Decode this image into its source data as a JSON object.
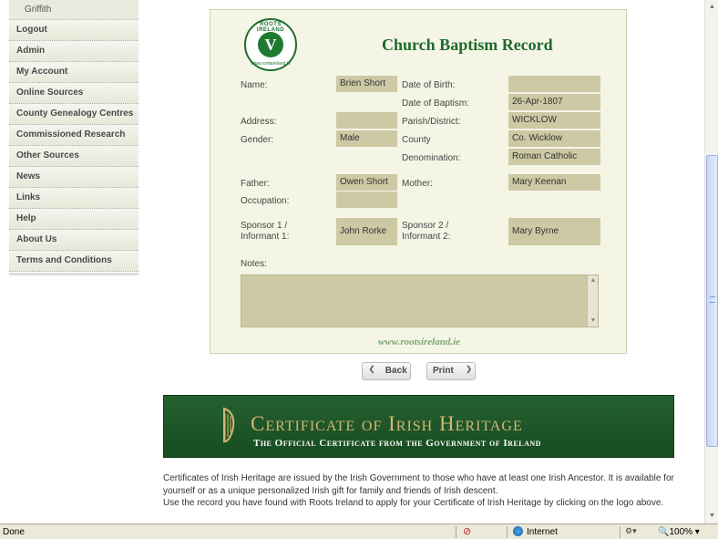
{
  "sidebar": {
    "sub_item": "Griffith",
    "items": [
      {
        "label": "Logout"
      },
      {
        "label": "Admin"
      },
      {
        "label": "My Account"
      },
      {
        "label": "Online Sources"
      },
      {
        "label": "County Genealogy Centres"
      },
      {
        "label": "Commissioned Research"
      },
      {
        "label": "Other Sources"
      },
      {
        "label": "News"
      },
      {
        "label": "Links"
      },
      {
        "label": "Help"
      },
      {
        "label": "About Us"
      },
      {
        "label": "Terms and Conditions"
      }
    ]
  },
  "record": {
    "title": "Church Baptism Record",
    "logo_top": "ROOTS IRELAND",
    "logo_bottom": "www.rootsireland.ie",
    "fields": {
      "name_label": "Name:",
      "name": "Brien Short",
      "dob_label": "Date of Birth:",
      "dob": "",
      "dobap_label": "Date of Baptism:",
      "dobap": "26-Apr-1807",
      "address_label": "Address:",
      "address": "",
      "parish_label": "Parish/District:",
      "parish": "WICKLOW",
      "gender_label": "Gender:",
      "gender": "Male",
      "county_label": "County",
      "county": "Co. Wicklow",
      "denom_label": "Denomination:",
      "denom": "Roman Catholic",
      "father_label": "Father:",
      "father": "Owen Short",
      "mother_label": "Mother:",
      "mother": "Mary Keenan",
      "occupation_label": "Occupation:",
      "occupation": "",
      "sponsor1_label_a": "Sponsor 1 /",
      "sponsor1_label_b": "Informant 1:",
      "sponsor1": "John Rorke",
      "sponsor2_label_a": "Sponsor 2 /",
      "sponsor2_label_b": "Informant 2:",
      "sponsor2": "Mary Byrne",
      "notes_label": "Notes:",
      "notes": ""
    },
    "footer_url": "www.rootsireland.ie"
  },
  "buttons": {
    "back": "Back",
    "print": "Print"
  },
  "certificate": {
    "title": "Certificate of Irish Heritage",
    "subtitle": "The Official Certificate from the Government of Ireland",
    "text_1": "Certificates of Irish Heritage are issued by the Irish Government to those who have at least one Irish Ancestor. It is available for yourself or as a unique personalized Irish gift for family and friends of Irish descent.",
    "text_2": "Use the record you have found with Roots Ireland to apply for your Certificate of Irish Heritage by clicking on the logo above."
  },
  "statusbar": {
    "status": "Done",
    "zone": "Internet",
    "zoom": "100%"
  },
  "colors": {
    "brand_green": "#1d6a2c",
    "field_bg": "#cdc9a5",
    "panel_bg": "#f5f5e6"
  }
}
